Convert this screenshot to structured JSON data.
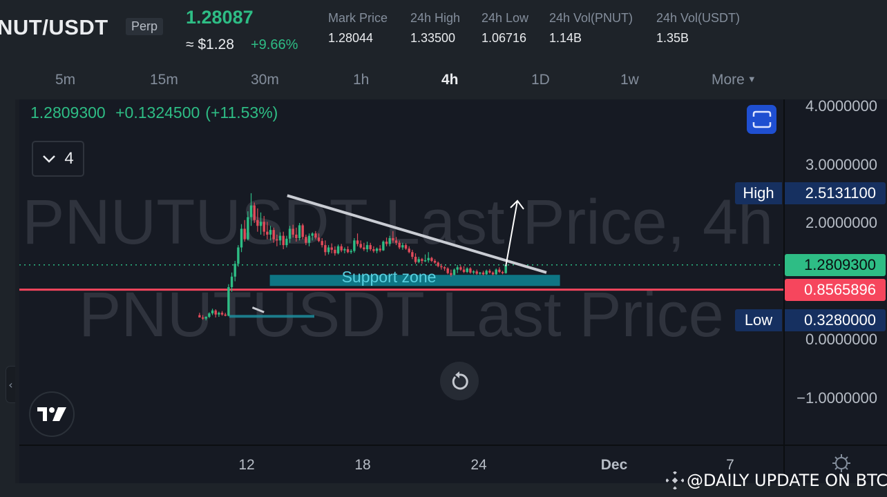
{
  "header": {
    "symbol": "NUT/USDT",
    "contract_type": "Perp",
    "last_price": "1.28087",
    "approx_usd": "≈ $1.28",
    "change_pct": "+9.66%",
    "stats": [
      {
        "label": "Mark Price",
        "value": "1.28044"
      },
      {
        "label": "24h High",
        "value": "1.33500"
      },
      {
        "label": "24h Low",
        "value": "1.06716"
      },
      {
        "label": "24h Vol(PNUT)",
        "value": "1.14B"
      },
      {
        "label": "24h Vol(USDT)",
        "value": "1.35B"
      }
    ]
  },
  "intervals": {
    "items": [
      "5m",
      "15m",
      "30m",
      "1h",
      "4h",
      "1D",
      "1w"
    ],
    "active": "4h",
    "more_label": "More"
  },
  "chart_legend": {
    "close": "1.2809300",
    "change": "+0.1324500",
    "change_pct": "(+11.53%)"
  },
  "indicator_toggle": {
    "count": "4",
    "icon": "chevron-down-icon"
  },
  "watermark": {
    "line1": "PNUTUSDT Last Price, 4h",
    "line2": "PNUTUSDT Last Price"
  },
  "colors": {
    "up": "#2ebd85",
    "down": "#e04b5a",
    "support_zone": "#0e7a8a",
    "hline": "#f6465d",
    "trendline": "#c9ccd3",
    "accent": "#1f4fd1"
  },
  "price_tags": {
    "high_label": "High",
    "high_value": "2.5131100",
    "last_value": "1.2809300",
    "line_value": "0.8565896",
    "low_label": "Low",
    "low_value": "0.3280000"
  },
  "annotations": {
    "support_label": "Support zone"
  },
  "watermark_credit": "@DAILY UPDATE ON BTC",
  "chart_data": {
    "type": "candlestick",
    "symbol": "PNUTUSDT",
    "interval": "4h",
    "title": "PNUTUSDT Last Price, 4h",
    "ylim": [
      -1.2,
      4.1
    ],
    "yticks": [
      4.0,
      3.0,
      2.0,
      1.0,
      0.0,
      -1.0
    ],
    "ytick_labels": [
      "4.0000000",
      "3.0000000",
      "2.0000000",
      "1.0000000",
      "0.0000000",
      "−1.0000000"
    ],
    "xlim_day": [
      1.8,
      41.0
    ],
    "xticks": [
      {
        "day": 12,
        "label": "12",
        "bold": false
      },
      {
        "day": 18,
        "label": "18",
        "bold": false
      },
      {
        "day": 24,
        "label": "24",
        "bold": false
      },
      {
        "day": 31,
        "label": "Dec",
        "bold": true
      },
      {
        "day": 37,
        "label": "7",
        "bold": false
      }
    ],
    "high": 2.51311,
    "low": 0.328,
    "last": 1.28093,
    "horizontal_line": 0.8565896,
    "support_zone": {
      "from_day": 13.2,
      "to_day": 28.2,
      "low": 0.92,
      "high": 1.11
    },
    "small_support": {
      "from_day": 11.1,
      "to_day": 15.5,
      "value": 0.4
    },
    "trendline": {
      "from": {
        "day": 14.1,
        "price": 2.47
      },
      "to": {
        "day": 27.5,
        "price": 1.15
      }
    },
    "small_trendline": {
      "from": {
        "day": 12.3,
        "price": 0.55
      },
      "to": {
        "day": 12.9,
        "price": 0.47
      }
    },
    "breakout_arrow": {
      "from": {
        "day": 25.4,
        "price": 1.26
      },
      "to": {
        "day": 26.0,
        "price": 2.38
      }
    },
    "candles": [
      {
        "o": 0.42,
        "h": 0.46,
        "l": 0.38,
        "c": 0.38
      },
      {
        "o": 0.38,
        "h": 0.42,
        "l": 0.34,
        "c": 0.36
      },
      {
        "o": 0.36,
        "h": 0.4,
        "l": 0.33,
        "c": 0.39
      },
      {
        "o": 0.39,
        "h": 0.47,
        "l": 0.37,
        "c": 0.45
      },
      {
        "o": 0.45,
        "h": 0.53,
        "l": 0.42,
        "c": 0.5
      },
      {
        "o": 0.5,
        "h": 0.52,
        "l": 0.38,
        "c": 0.43
      },
      {
        "o": 0.43,
        "h": 0.48,
        "l": 0.39,
        "c": 0.46
      },
      {
        "o": 0.46,
        "h": 0.49,
        "l": 0.41,
        "c": 0.43
      },
      {
        "o": 0.43,
        "h": 0.46,
        "l": 0.4,
        "c": 0.41
      },
      {
        "o": 0.41,
        "h": 0.95,
        "l": 0.4,
        "c": 0.9
      },
      {
        "o": 0.9,
        "h": 1.15,
        "l": 0.82,
        "c": 1.08
      },
      {
        "o": 1.08,
        "h": 1.35,
        "l": 1.0,
        "c": 1.3
      },
      {
        "o": 1.3,
        "h": 1.62,
        "l": 1.25,
        "c": 1.58
      },
      {
        "o": 1.58,
        "h": 1.98,
        "l": 1.5,
        "c": 1.9
      },
      {
        "o": 1.9,
        "h": 2.05,
        "l": 1.68,
        "c": 1.72
      },
      {
        "o": 1.72,
        "h": 2.2,
        "l": 1.7,
        "c": 2.1
      },
      {
        "o": 2.1,
        "h": 2.51,
        "l": 1.95,
        "c": 2.3
      },
      {
        "o": 2.3,
        "h": 2.35,
        "l": 2.0,
        "c": 2.05
      },
      {
        "o": 2.05,
        "h": 2.25,
        "l": 1.85,
        "c": 1.95
      },
      {
        "o": 1.95,
        "h": 2.18,
        "l": 1.8,
        "c": 2.02
      },
      {
        "o": 2.02,
        "h": 2.12,
        "l": 1.78,
        "c": 1.85
      },
      {
        "o": 1.85,
        "h": 2.02,
        "l": 1.72,
        "c": 1.8
      },
      {
        "o": 1.8,
        "h": 1.95,
        "l": 1.7,
        "c": 1.88
      },
      {
        "o": 1.88,
        "h": 1.92,
        "l": 1.66,
        "c": 1.72
      },
      {
        "o": 1.72,
        "h": 1.8,
        "l": 1.6,
        "c": 1.7
      },
      {
        "o": 1.7,
        "h": 1.84,
        "l": 1.62,
        "c": 1.78
      },
      {
        "o": 1.78,
        "h": 1.85,
        "l": 1.55,
        "c": 1.62
      },
      {
        "o": 1.62,
        "h": 1.78,
        "l": 1.58,
        "c": 1.73
      },
      {
        "o": 1.73,
        "h": 1.95,
        "l": 1.66,
        "c": 1.9
      },
      {
        "o": 1.9,
        "h": 1.97,
        "l": 1.75,
        "c": 1.8
      },
      {
        "o": 1.8,
        "h": 1.92,
        "l": 1.68,
        "c": 1.74
      },
      {
        "o": 1.74,
        "h": 2.0,
        "l": 1.7,
        "c": 1.96
      },
      {
        "o": 1.96,
        "h": 1.99,
        "l": 1.72,
        "c": 1.76
      },
      {
        "o": 1.76,
        "h": 1.8,
        "l": 1.62,
        "c": 1.66
      },
      {
        "o": 1.66,
        "h": 1.82,
        "l": 1.6,
        "c": 1.78
      },
      {
        "o": 1.78,
        "h": 1.84,
        "l": 1.7,
        "c": 1.82
      },
      {
        "o": 1.82,
        "h": 1.86,
        "l": 1.72,
        "c": 1.75
      },
      {
        "o": 1.75,
        "h": 1.82,
        "l": 1.67,
        "c": 1.69
      },
      {
        "o": 1.69,
        "h": 1.74,
        "l": 1.58,
        "c": 1.62
      },
      {
        "o": 1.62,
        "h": 1.7,
        "l": 1.44,
        "c": 1.5
      },
      {
        "o": 1.5,
        "h": 1.62,
        "l": 1.46,
        "c": 1.58
      },
      {
        "o": 1.58,
        "h": 1.65,
        "l": 1.48,
        "c": 1.54
      },
      {
        "o": 1.54,
        "h": 1.6,
        "l": 1.44,
        "c": 1.48
      },
      {
        "o": 1.48,
        "h": 1.63,
        "l": 1.46,
        "c": 1.6
      },
      {
        "o": 1.6,
        "h": 1.64,
        "l": 1.5,
        "c": 1.53
      },
      {
        "o": 1.53,
        "h": 1.58,
        "l": 1.48,
        "c": 1.55
      },
      {
        "o": 1.55,
        "h": 1.6,
        "l": 1.48,
        "c": 1.5
      },
      {
        "o": 1.5,
        "h": 1.55,
        "l": 1.47,
        "c": 1.52
      },
      {
        "o": 1.52,
        "h": 1.74,
        "l": 1.49,
        "c": 1.7
      },
      {
        "o": 1.7,
        "h": 1.82,
        "l": 1.6,
        "c": 1.64
      },
      {
        "o": 1.64,
        "h": 1.7,
        "l": 1.56,
        "c": 1.58
      },
      {
        "o": 1.58,
        "h": 1.66,
        "l": 1.52,
        "c": 1.55
      },
      {
        "o": 1.55,
        "h": 1.68,
        "l": 1.5,
        "c": 1.62
      },
      {
        "o": 1.62,
        "h": 1.66,
        "l": 1.52,
        "c": 1.55
      },
      {
        "o": 1.55,
        "h": 1.6,
        "l": 1.49,
        "c": 1.52
      },
      {
        "o": 1.52,
        "h": 1.58,
        "l": 1.48,
        "c": 1.56
      },
      {
        "o": 1.56,
        "h": 1.62,
        "l": 1.5,
        "c": 1.53
      },
      {
        "o": 1.53,
        "h": 1.7,
        "l": 1.52,
        "c": 1.68
      },
      {
        "o": 1.68,
        "h": 1.75,
        "l": 1.6,
        "c": 1.64
      },
      {
        "o": 1.64,
        "h": 1.78,
        "l": 1.6,
        "c": 1.74
      },
      {
        "o": 1.74,
        "h": 1.86,
        "l": 1.66,
        "c": 1.7
      },
      {
        "o": 1.7,
        "h": 1.76,
        "l": 1.62,
        "c": 1.66
      },
      {
        "o": 1.66,
        "h": 1.7,
        "l": 1.55,
        "c": 1.58
      },
      {
        "o": 1.58,
        "h": 1.66,
        "l": 1.54,
        "c": 1.62
      },
      {
        "o": 1.62,
        "h": 1.65,
        "l": 1.54,
        "c": 1.56
      },
      {
        "o": 1.56,
        "h": 1.6,
        "l": 1.48,
        "c": 1.5
      },
      {
        "o": 1.5,
        "h": 1.54,
        "l": 1.38,
        "c": 1.42
      },
      {
        "o": 1.42,
        "h": 1.48,
        "l": 1.3,
        "c": 1.33
      },
      {
        "o": 1.33,
        "h": 1.42,
        "l": 1.31,
        "c": 1.38
      },
      {
        "o": 1.38,
        "h": 1.4,
        "l": 1.3,
        "c": 1.35
      },
      {
        "o": 1.35,
        "h": 1.46,
        "l": 1.33,
        "c": 1.36
      },
      {
        "o": 1.36,
        "h": 1.5,
        "l": 1.32,
        "c": 1.4
      },
      {
        "o": 1.4,
        "h": 1.42,
        "l": 1.33,
        "c": 1.35
      },
      {
        "o": 1.35,
        "h": 1.38,
        "l": 1.3,
        "c": 1.32
      },
      {
        "o": 1.32,
        "h": 1.34,
        "l": 1.24,
        "c": 1.26
      },
      {
        "o": 1.26,
        "h": 1.3,
        "l": 1.2,
        "c": 1.24
      },
      {
        "o": 1.24,
        "h": 1.26,
        "l": 1.18,
        "c": 1.22
      },
      {
        "o": 1.22,
        "h": 1.24,
        "l": 1.12,
        "c": 1.14
      },
      {
        "o": 1.14,
        "h": 1.2,
        "l": 1.08,
        "c": 1.11
      },
      {
        "o": 1.11,
        "h": 1.22,
        "l": 1.1,
        "c": 1.2
      },
      {
        "o": 1.2,
        "h": 1.28,
        "l": 1.14,
        "c": 1.24
      },
      {
        "o": 1.24,
        "h": 1.27,
        "l": 1.18,
        "c": 1.2
      },
      {
        "o": 1.2,
        "h": 1.26,
        "l": 1.14,
        "c": 1.16
      },
      {
        "o": 1.16,
        "h": 1.24,
        "l": 1.14,
        "c": 1.22
      },
      {
        "o": 1.22,
        "h": 1.24,
        "l": 1.13,
        "c": 1.15
      },
      {
        "o": 1.15,
        "h": 1.19,
        "l": 1.12,
        "c": 1.17
      },
      {
        "o": 1.17,
        "h": 1.2,
        "l": 1.11,
        "c": 1.13
      },
      {
        "o": 1.13,
        "h": 1.16,
        "l": 1.11,
        "c": 1.15
      },
      {
        "o": 1.15,
        "h": 1.18,
        "l": 1.1,
        "c": 1.12
      },
      {
        "o": 1.12,
        "h": 1.2,
        "l": 1.11,
        "c": 1.18
      },
      {
        "o": 1.18,
        "h": 1.21,
        "l": 1.13,
        "c": 1.15
      },
      {
        "o": 1.15,
        "h": 1.17,
        "l": 1.1,
        "c": 1.12
      },
      {
        "o": 1.12,
        "h": 1.22,
        "l": 1.11,
        "c": 1.2
      },
      {
        "o": 1.2,
        "h": 1.24,
        "l": 1.14,
        "c": 1.16
      },
      {
        "o": 1.16,
        "h": 1.18,
        "l": 1.12,
        "c": 1.14
      },
      {
        "o": 1.14,
        "h": 1.3,
        "l": 1.13,
        "c": 1.28
      }
    ]
  }
}
